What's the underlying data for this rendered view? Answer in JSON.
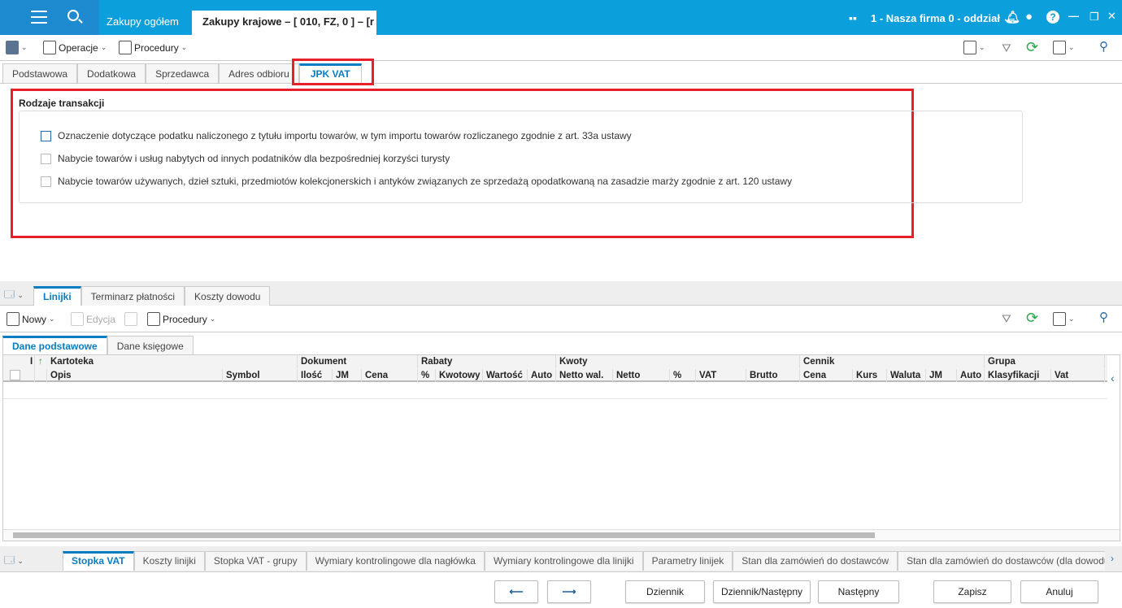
{
  "titlebar": {
    "tabs": [
      "Zakupy ogółem",
      "Zakupy krajowe – [ 010, FZ, 0 ] – [r"
    ],
    "company": "1 - Nasza firma 0 - oddział"
  },
  "toolbar": {
    "operations": "Operacje",
    "procedures": "Procedury"
  },
  "form_tabs": [
    "Podstawowa",
    "Dodatkowa",
    "Sprzedawca",
    "Adres odbioru",
    "JPK VAT"
  ],
  "section": {
    "title": "Rodzaje transakcji",
    "options": [
      {
        "label": "Oznaczenie dotyczące podatku naliczonego z tytułu importu towarów, w tym importu towarów rozliczanego zgodnie z art. 33a ustawy",
        "checked": false
      },
      {
        "label": "Nabycie towarów i usług nabytych od innych podatników dla bezpośredniej korzyści turysty",
        "checked": false
      },
      {
        "label": "Nabycie towarów używanych, dzieł sztuki, przedmiotów kolekcjonerskich i antyków związanych ze sprzedażą opodatkowaną na zasadzie marży zgodnie z art. 120 ustawy",
        "checked": false
      }
    ]
  },
  "lower_tabs": [
    "Linijki",
    "Terminarz płatności",
    "Koszty dowodu"
  ],
  "lines_toolbar": {
    "new": "Nowy",
    "edit": "Edycja",
    "procedures": "Procedury"
  },
  "grid_tabs": [
    "Dane podstawowe",
    "Dane księgowe"
  ],
  "grid": {
    "groups": [
      "Kartoteka",
      "Dokument",
      "Rabaty",
      "Kwoty",
      "Cennik",
      "Grupa"
    ],
    "columns": [
      "I",
      "",
      "Opis",
      "Symbol",
      "Ilość",
      "JM",
      "Cena",
      "%",
      "Kwotowy",
      "Wartość",
      "Auto",
      "Netto wal.",
      "Netto",
      "%",
      "VAT",
      "Brutto",
      "Cena",
      "Kurs",
      "Waluta",
      "JM",
      "Auto",
      "Klasyfikacji",
      "Vat"
    ]
  },
  "bottom_tabs": [
    "Stopka VAT",
    "Koszty linijki",
    "Stopka VAT - grupy",
    "Wymiary kontrolingowe dla nagłówka",
    "Wymiary kontrolingowe dla linijki",
    "Parametry linijek",
    "Stan dla zamówień do dostawców",
    "Stan dla zamówień do dostawców (dla dowodu"
  ],
  "buttons": {
    "prev": "⟵",
    "next": "⟶",
    "journal": "Dziennik",
    "journal_next": "Dziennik/Następny",
    "next_doc": "Następny",
    "save": "Zapisz",
    "cancel": "Anuluj"
  },
  "colors": {
    "accent": "#0a7cc1",
    "titlebar": "#0b9fdc",
    "highlight": "#e8202a"
  }
}
